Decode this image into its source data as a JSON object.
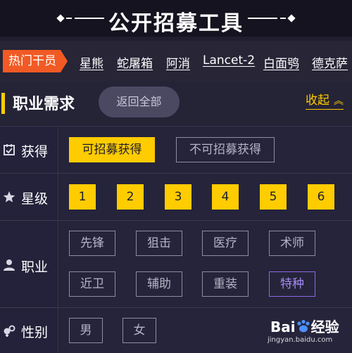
{
  "header": {
    "title": "公开招募工具"
  },
  "operators": {
    "hot_label": "热门干员",
    "items": [
      "星熊",
      "蛇屠箱",
      "阿消",
      "Lancet-2",
      "白面鸮",
      "德克萨"
    ]
  },
  "requirements": {
    "title": "职业需求",
    "back_all": "返回全部",
    "collapse": "收起"
  },
  "obtain": {
    "label": "获得",
    "options": [
      "可招募获得",
      "不可招募获得"
    ],
    "selected": "可招募获得"
  },
  "rarity": {
    "label": "星级",
    "options": [
      "1",
      "2",
      "3",
      "4",
      "5",
      "6"
    ]
  },
  "profession": {
    "label": "职业",
    "options": [
      "先锋",
      "狙击",
      "医疗",
      "术师",
      "近卫",
      "辅助",
      "重装",
      "特种"
    ],
    "highlighted": "特种"
  },
  "gender": {
    "label": "性别",
    "options": [
      "男",
      "女"
    ]
  },
  "watermark": {
    "text_a": "Bai",
    "text_b": "经验",
    "url": "jingyan.baidu.com"
  },
  "colors": {
    "accent_yellow": "#ffcc00",
    "hot_orange": "#f15a24",
    "special_purple": "#8a6ae8",
    "background": "#1f1d2e"
  }
}
